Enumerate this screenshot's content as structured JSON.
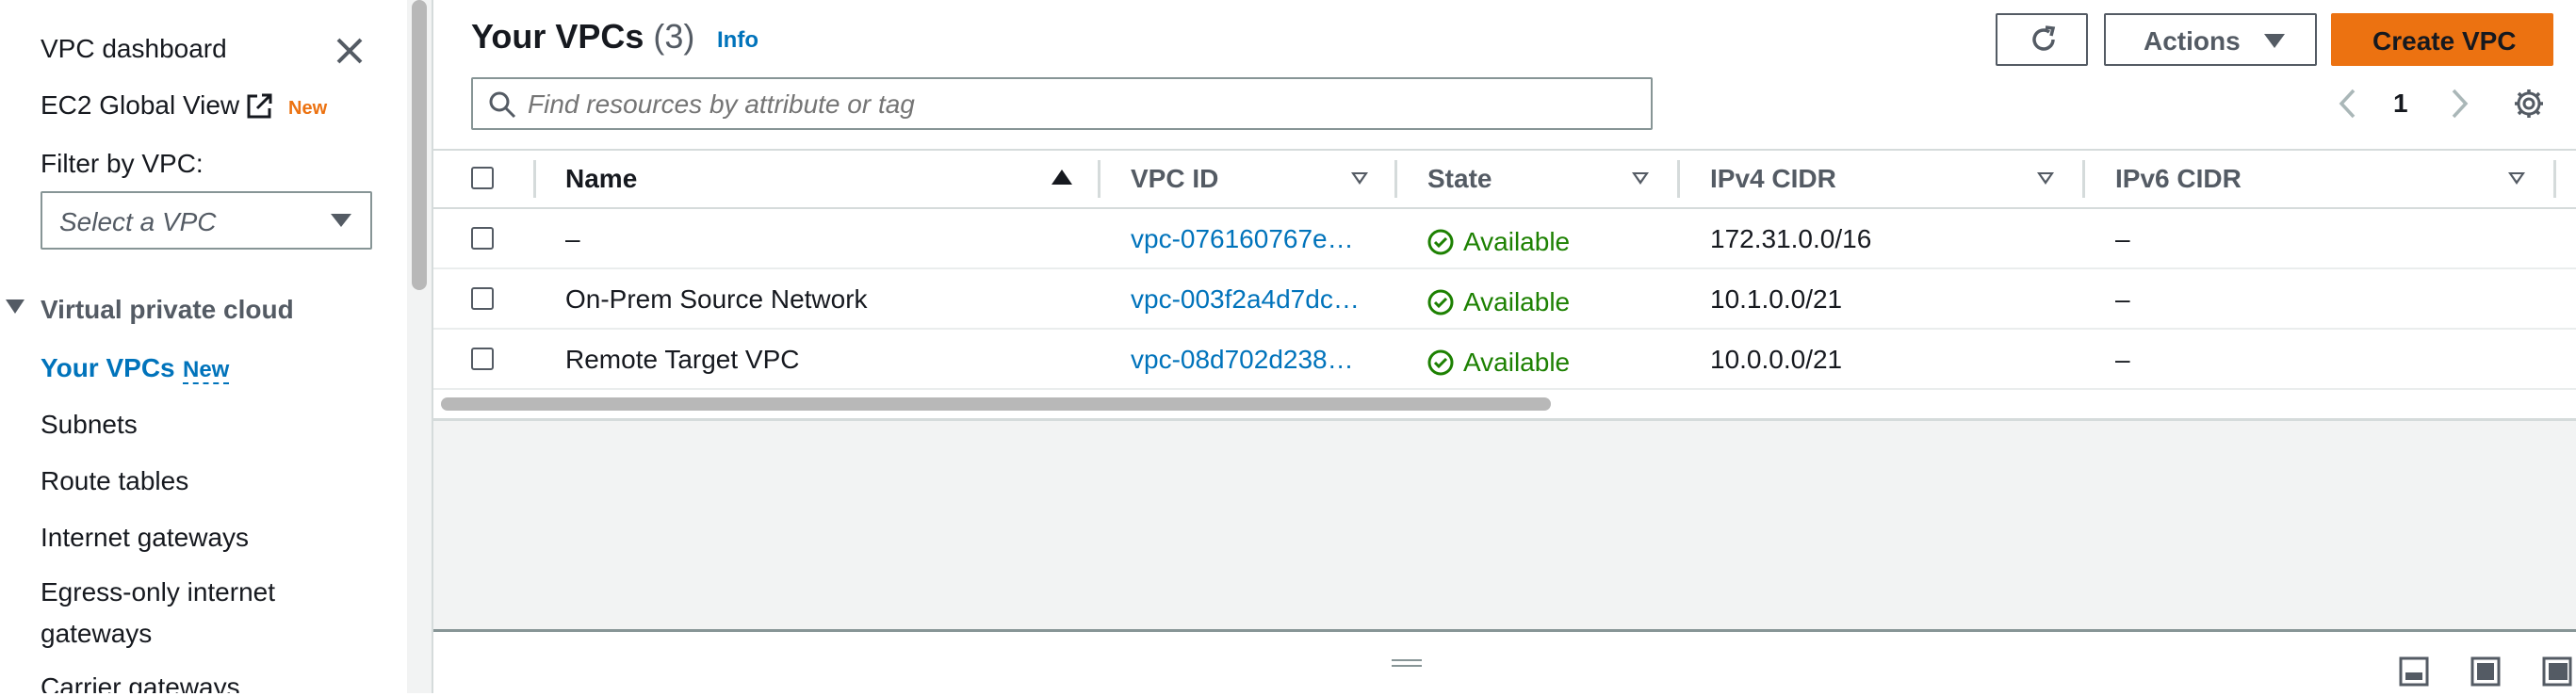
{
  "sidebar": {
    "dashboard": "VPC dashboard",
    "ec2_global_view": "EC2 Global View",
    "ec2_badge": "New",
    "filter_label": "Filter by VPC:",
    "filter_placeholder": "Select a VPC",
    "section_title": "Virtual private cloud",
    "items": [
      {
        "label": "Your VPCs",
        "badge": "New",
        "active": true
      },
      {
        "label": "Subnets"
      },
      {
        "label": "Route tables"
      },
      {
        "label": "Internet gateways"
      },
      {
        "label": "Egress-only internet gateways"
      },
      {
        "label": "Carrier gateways"
      }
    ]
  },
  "header": {
    "title": "Your VPCs",
    "count": "(3)",
    "info": "Info",
    "actions_label": "Actions",
    "create_label": "Create VPC"
  },
  "search": {
    "placeholder": "Find resources by attribute or tag"
  },
  "pagination": {
    "page": "1"
  },
  "table": {
    "columns": [
      "Name",
      "VPC ID",
      "State",
      "IPv4 CIDR",
      "IPv6 CIDR"
    ],
    "rows": [
      {
        "name": "–",
        "vpc_id": "vpc-076160767e…",
        "state": "Available",
        "ipv4": "172.31.0.0/16",
        "ipv6": "–"
      },
      {
        "name": "On-Prem Source Network",
        "vpc_id": "vpc-003f2a4d7dc…",
        "state": "Available",
        "ipv4": "10.1.0.0/21",
        "ipv6": "–"
      },
      {
        "name": "Remote Target VPC",
        "vpc_id": "vpc-08d702d238…",
        "state": "Available",
        "ipv4": "10.0.0.0/21",
        "ipv6": "–"
      }
    ]
  },
  "colors": {
    "accent": "#ec7211",
    "link": "#0073bb",
    "available": "#1d8102"
  },
  "icons": [
    "close-icon",
    "external-link-icon",
    "caret-down-icon",
    "refresh-icon",
    "search-icon",
    "chevron-left-icon",
    "chevron-right-icon",
    "settings-icon",
    "check-circle-icon",
    "drag-handle-icon",
    "panel-icon"
  ]
}
